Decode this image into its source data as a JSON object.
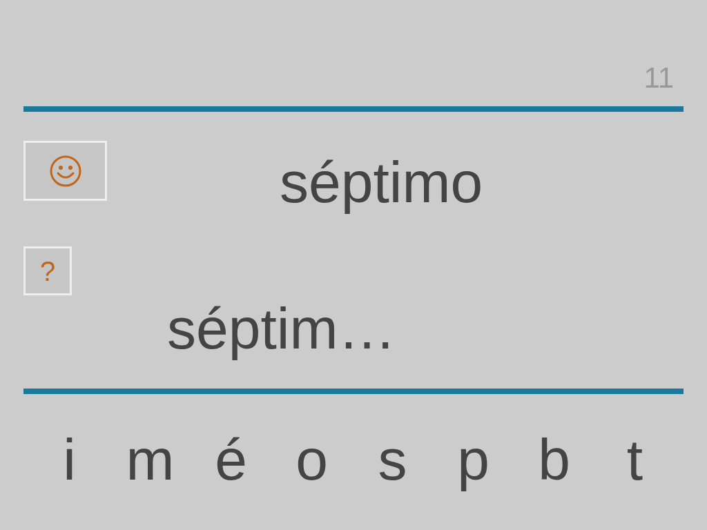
{
  "page_number": "11",
  "word": "séptimo",
  "buttons": [
    {
      "kind": "smiley"
    },
    {
      "kind": "hint",
      "label": "?"
    }
  ],
  "answer": "séptim…",
  "letters": [
    "i",
    "m",
    "é",
    "o",
    "s",
    "p",
    "b",
    "t"
  ]
}
